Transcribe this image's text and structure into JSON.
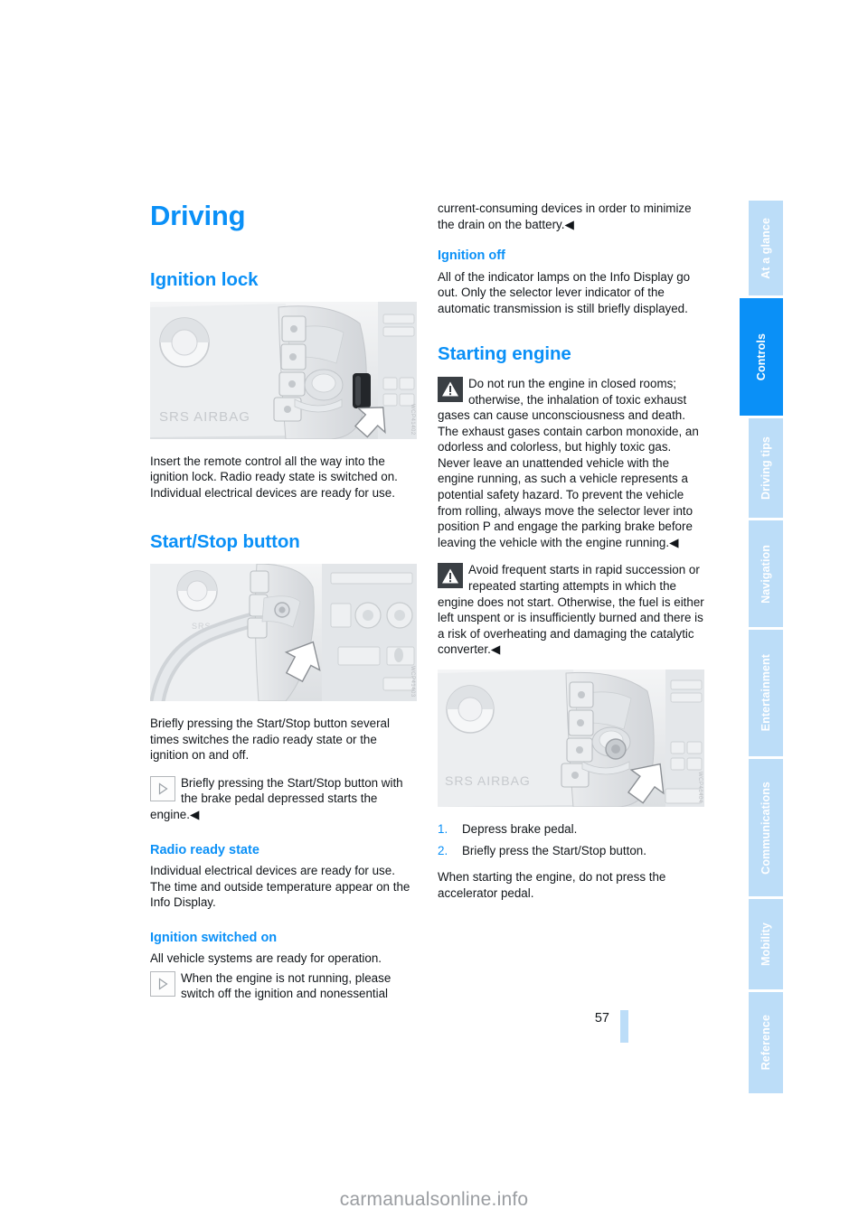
{
  "document": {
    "title": "Driving",
    "page_number": "57",
    "watermark": "carmanualsonline.info"
  },
  "sidebar": {
    "tabs": [
      {
        "label": "At a glance",
        "active": false
      },
      {
        "label": "Controls",
        "active": true
      },
      {
        "label": "Driving tips",
        "active": false
      },
      {
        "label": "Navigation",
        "active": false
      },
      {
        "label": "Entertainment",
        "active": false
      },
      {
        "label": "Communications",
        "active": false
      },
      {
        "label": "Mobility",
        "active": false
      },
      {
        "label": "Reference",
        "active": false
      }
    ]
  },
  "left_column": {
    "section_ignition_lock": {
      "heading": "Ignition lock",
      "image_alt": "BMW steering wheel and ignition lock with arrow pointing to key slot",
      "image_code": "WCP41402",
      "paragraph": "Insert the remote control all the way into the ignition lock. Radio ready state is switched on. Individual electrical devices are ready for use."
    },
    "section_start_stop": {
      "heading": "Start/Stop button",
      "image_alt": "BMW dashboard with arrow pointing to the Start/Stop button",
      "image_code": "WCP41403",
      "paragraph": "Briefly pressing the Start/Stop button several times switches the radio ready state or the ignition on and off.",
      "note": {
        "icon": "info-play-icon",
        "text": "Briefly pressing the Start/Stop button with the brake pedal depressed starts the engine.",
        "end_mark": "◀"
      }
    },
    "section_radio_ready": {
      "heading": "Radio ready state",
      "paragraph": "Individual electrical devices are ready for use. The time and outside temperature appear on the Info Display."
    },
    "section_ignition_on": {
      "heading": "Ignition switched on",
      "paragraph": "All vehicle systems are ready for operation.",
      "note": {
        "icon": "info-play-icon",
        "text": "When the engine is not running, please switch off the ignition and nonessential"
      }
    }
  },
  "right_column": {
    "note_continued": {
      "text": "current-consuming devices in order to minimize the drain on the battery.",
      "end_mark": "◀"
    },
    "section_ignition_off": {
      "heading": "Ignition off",
      "paragraph": "All of the indicator lamps on the Info Display go out. Only the selector lever indicator of the automatic transmission is still briefly displayed."
    },
    "section_starting_engine": {
      "heading": "Starting engine",
      "warning_1": {
        "icon": "warning-triangle-icon",
        "text": "Do not run the engine in closed rooms; otherwise, the inhalation of toxic exhaust gases can cause unconsciousness and death. The exhaust gases contain carbon monoxide, an odorless and colorless, but highly toxic gas. Never leave an unattended vehicle with the engine running, as such a vehicle represents a potential safety hazard. To prevent the vehicle from rolling, always move the selector lever into position P and engage the parking brake before leaving the vehicle with the engine running.",
        "end_mark": "◀"
      },
      "warning_2": {
        "icon": "warning-triangle-icon",
        "text": "Avoid frequent starts in rapid succession or repeated starting attempts in which the engine does not start. Otherwise, the fuel is either left unspent or is insufficiently burned and there is a risk of overheating and damaging the catalytic converter.",
        "end_mark": "◀"
      },
      "image_alt": "BMW steering column with arrow pointing to the Start/Stop button",
      "image_code": "WCP41404",
      "steps": [
        {
          "num": "1.",
          "text": "Depress brake pedal."
        },
        {
          "num": "2.",
          "text": "Briefly press the Start/Stop button."
        }
      ],
      "closing_paragraph": "When starting the engine, do not press the accelerator pedal."
    }
  },
  "colors": {
    "accent_blue": "#0a90f7",
    "tab_blue": "#bcddf8",
    "body_text": "#12161a",
    "watermark_gray": "#9a9da1"
  }
}
